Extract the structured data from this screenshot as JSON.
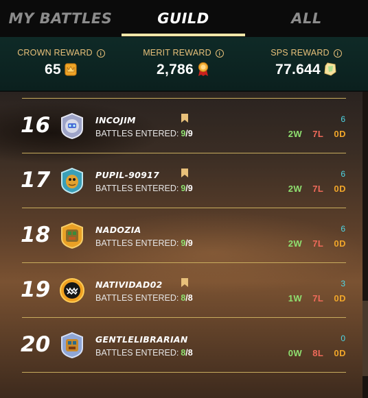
{
  "tabs": {
    "my_battles": "MY BATTLES",
    "guild": "GUILD",
    "all": "ALL",
    "active": "guild"
  },
  "rewards": {
    "crown": {
      "label": "CROWN REWARD",
      "value": "65",
      "icon": "crown-token-icon"
    },
    "merit": {
      "label": "MERIT REWARD",
      "value": "2,786",
      "icon": "merit-medal-icon"
    },
    "sps": {
      "label": "SPS REWARD",
      "value": "77.644",
      "icon": "sps-crystal-icon"
    },
    "info_glyph": "i"
  },
  "rows": [
    {
      "rank": "16",
      "name": "INCOJIM",
      "bookmarked": true,
      "battles_label": "BATTLES ENTERED:",
      "entered": "9",
      "sep": "/",
      "total": "9",
      "score": "6",
      "wins": "2W",
      "losses": "7L",
      "draws": "0D",
      "avatar": "robot-avatar-icon"
    },
    {
      "rank": "17",
      "name": "PUPIL-90917",
      "bookmarked": true,
      "battles_label": "BATTLES ENTERED:",
      "entered": "9",
      "sep": "/",
      "total": "9",
      "score": "6",
      "wins": "2W",
      "losses": "7L",
      "draws": "0D",
      "avatar": "lizard-avatar-icon"
    },
    {
      "rank": "18",
      "name": "NADOZIA",
      "bookmarked": false,
      "battles_label": "BATTLES ENTERED:",
      "entered": "9",
      "sep": "/",
      "total": "9",
      "score": "6",
      "wins": "2W",
      "losses": "7L",
      "draws": "0D",
      "avatar": "goblin-avatar-icon"
    },
    {
      "rank": "19",
      "name": "NATIVIDAD02",
      "bookmarked": true,
      "battles_label": "BATTLES ENTERED:",
      "entered": "8",
      "sep": "/",
      "total": "8",
      "score": "3",
      "wins": "1W",
      "losses": "7L",
      "draws": "0D",
      "avatar": "monster-avatar-icon"
    },
    {
      "rank": "20",
      "name": "GENTLELIBRARIAN",
      "bookmarked": false,
      "battles_label": "BATTLES ENTERED:",
      "entered": "8",
      "sep": "/",
      "total": "8",
      "score": "0",
      "wins": "0W",
      "losses": "8L",
      "draws": "0D",
      "avatar": "goblin-avatar-icon"
    }
  ],
  "colors": {
    "accent_gold": "#e8c07a",
    "win_green": "#8fe070",
    "loss_red": "#f06a5a",
    "draw_orange": "#f0a62a",
    "score_cyan": "#4fd9e8",
    "divider": "#c9ad5e"
  }
}
